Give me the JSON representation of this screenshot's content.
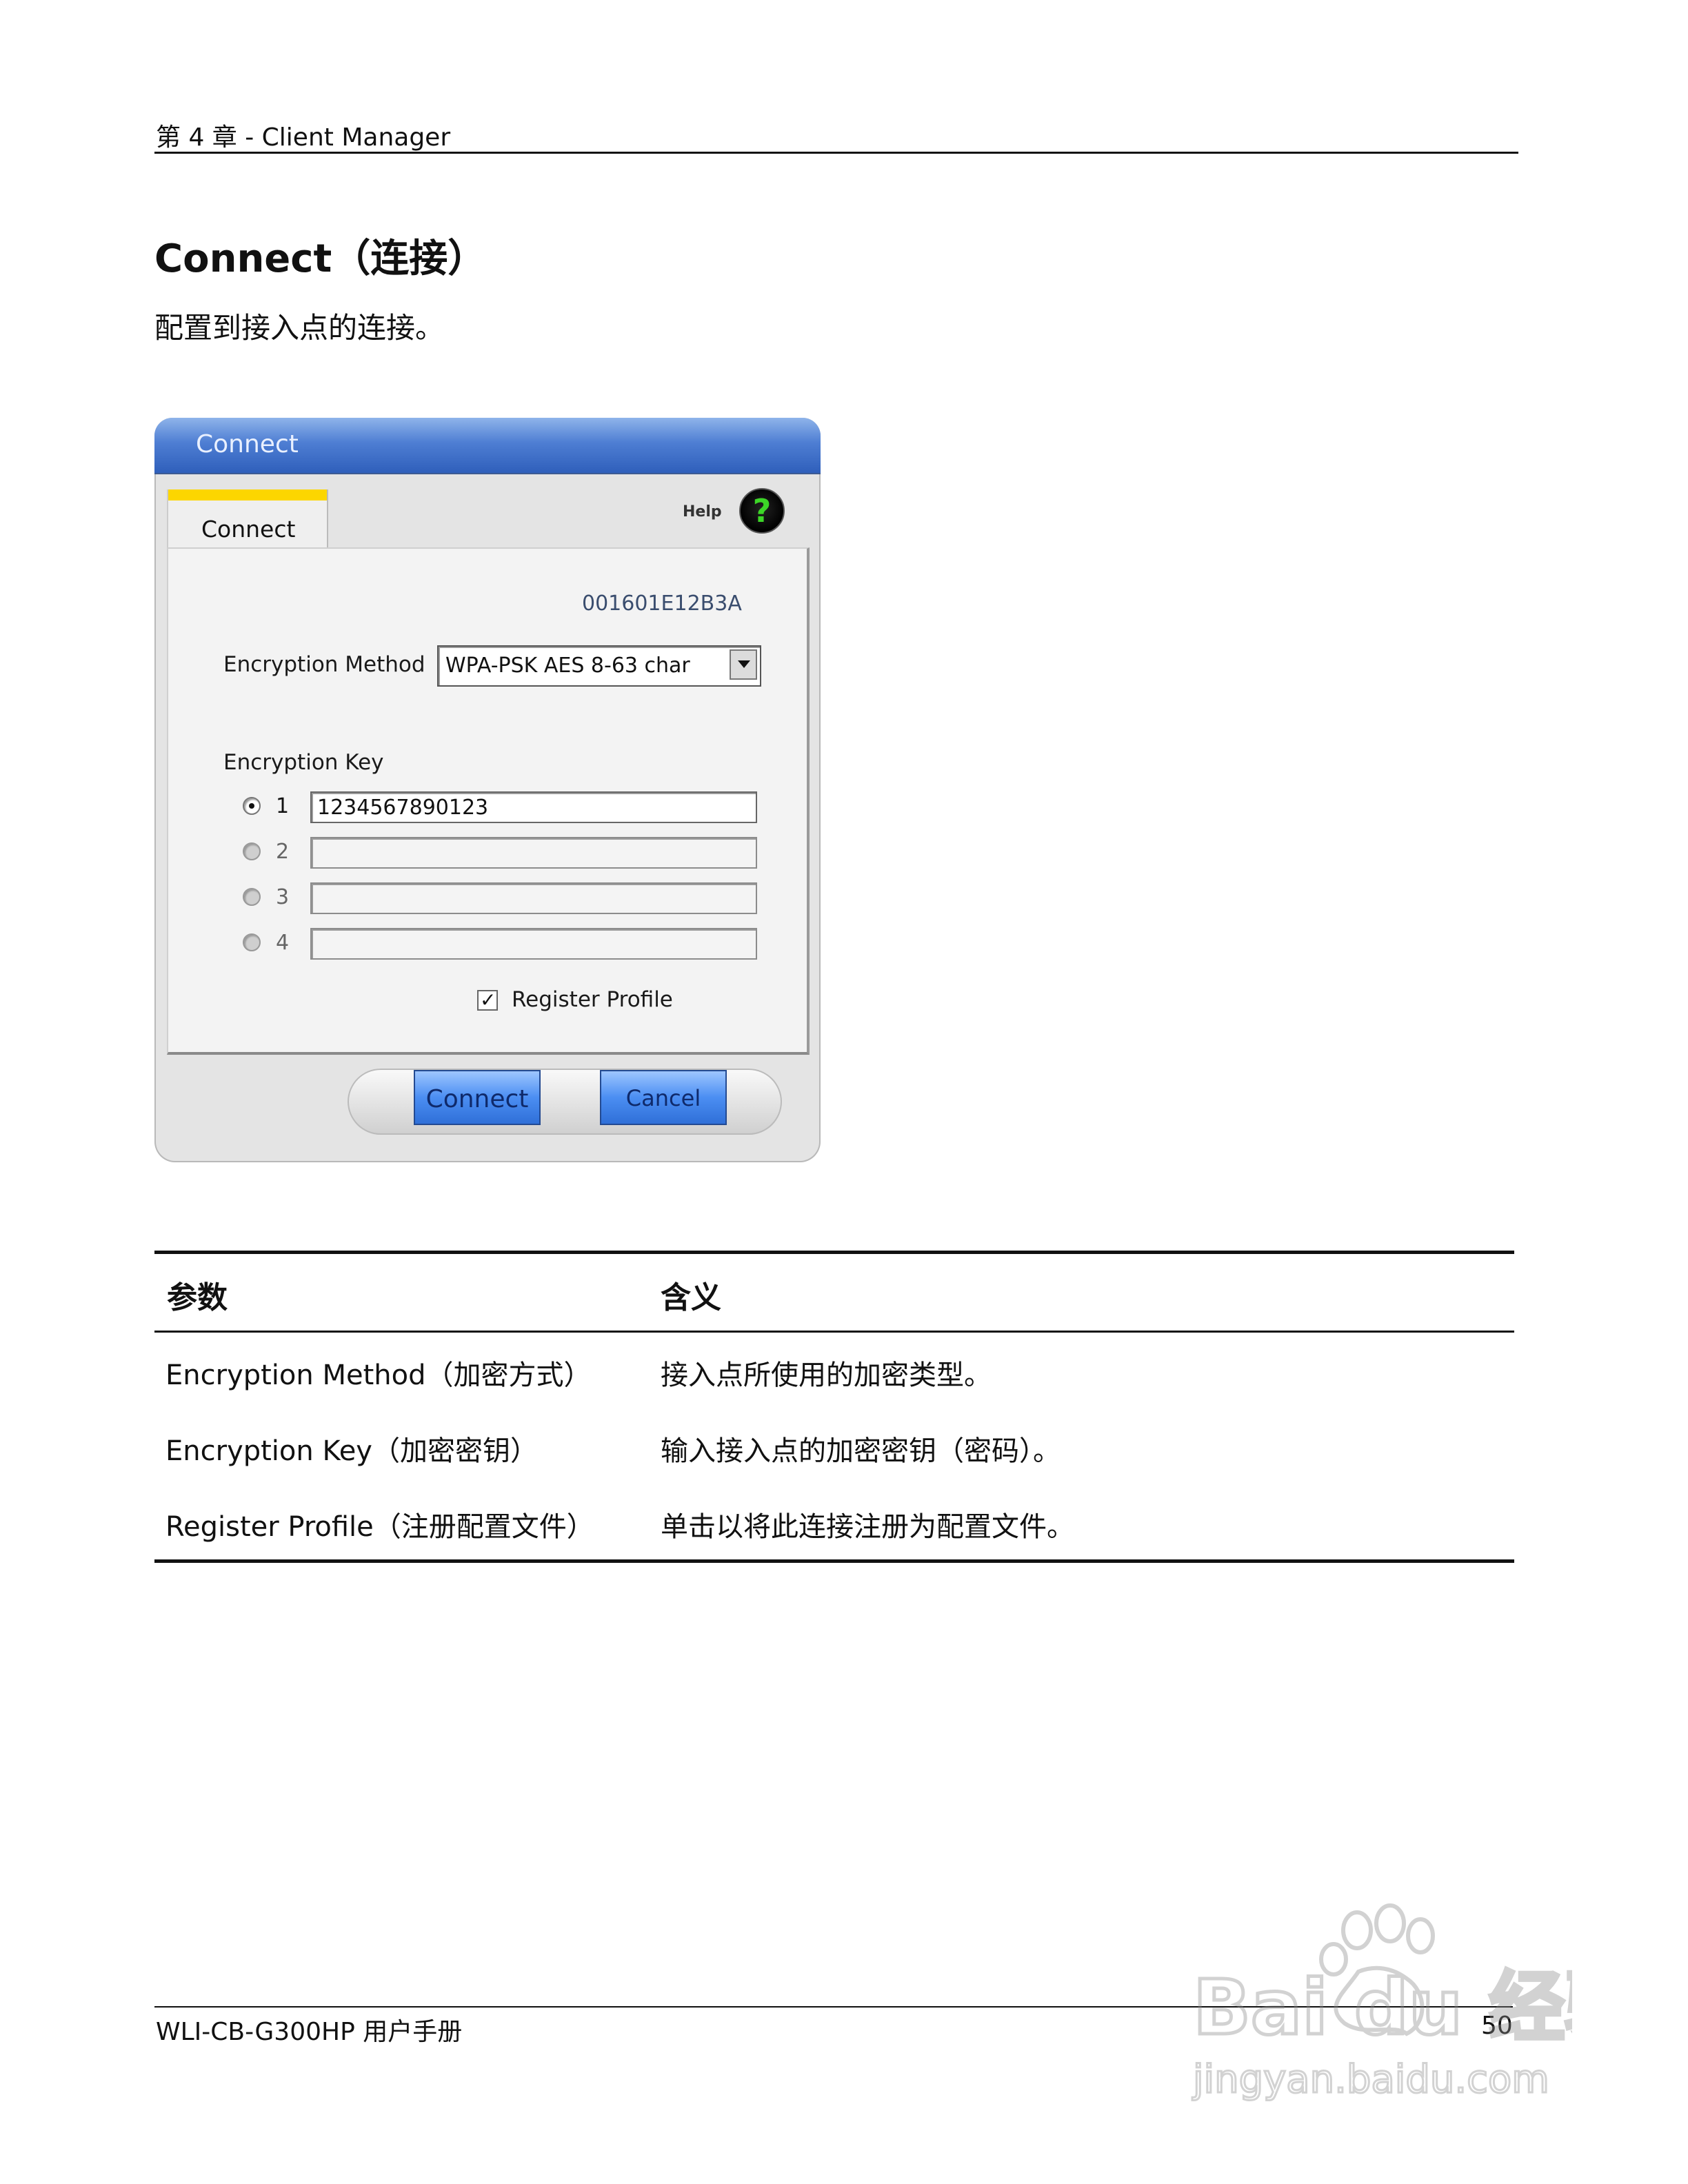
{
  "header": {
    "chapter": "第 4 章 - Client Manager"
  },
  "section": {
    "title": "Connect（连接）",
    "subtitle": "配置到接入点的连接。"
  },
  "dialog": {
    "title": "Connect",
    "tab_label": "Connect",
    "help_label": "Help",
    "help_icon_glyph": "?",
    "mac_address": "001601E12B3A",
    "encryption_method_label": "Encryption Method",
    "encryption_method_value": "WPA-PSK AES 8-63 char",
    "encryption_key_label": "Encryption Key",
    "keys": [
      {
        "number": "1",
        "value": "1234567890123",
        "selected": true
      },
      {
        "number": "2",
        "value": "",
        "selected": false
      },
      {
        "number": "3",
        "value": "",
        "selected": false
      },
      {
        "number": "4",
        "value": "",
        "selected": false
      }
    ],
    "register_profile_label": "Register Profile",
    "register_profile_checked": true,
    "checkmark_glyph": "✓",
    "connect_button": "Connect",
    "cancel_button": "Cancel",
    "colors": {
      "title_bar": "#4e7ed3",
      "tab_accent": "#fcd600",
      "help_glyph": "#3cd627"
    }
  },
  "table": {
    "headers": [
      "参数",
      "含义"
    ],
    "rows": [
      [
        "Encryption Method（加密方式）",
        "接入点所使用的加密类型。"
      ],
      [
        "Encryption Key（加密密钥）",
        "输入接入点的加密密钥（密码）。"
      ],
      [
        "Register Profile（注册配置文件）",
        "单击以将此连接注册为配置文件。"
      ]
    ]
  },
  "footer": {
    "manual_name": "WLI-CB-G300HP 用户手册",
    "page_number": "50"
  },
  "watermark": {
    "brand": "Bai du 经验",
    "url": "jingyan.baidu.com"
  }
}
